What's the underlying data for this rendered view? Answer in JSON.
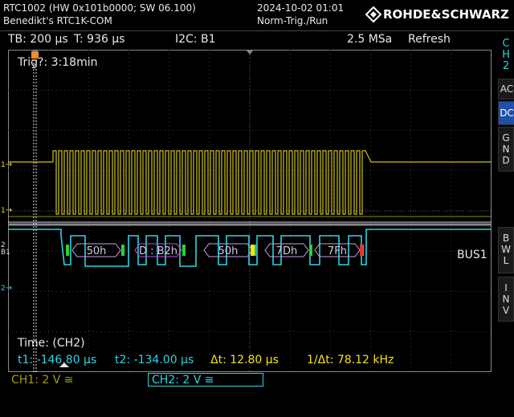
{
  "header": {
    "device": "RTC1002 (HW 0x101b0000; SW 06.100)",
    "user": "Benedikt's RTC1K-COM",
    "datetime": "2024-10-02 01:01",
    "trigger_state": "Norm-Trig./Run",
    "brand": "ROHDE&SCHWARZ"
  },
  "toolbar": {
    "timebase": "TB: 200 µs",
    "trigger_time": "T: 936 µs",
    "bus": "I2C: B1",
    "sample_rate": "2.5 MSa",
    "mode": "Refresh"
  },
  "side_panel": {
    "channel_label": "C\nH\n2",
    "ac": "AC",
    "dc": "DC",
    "gnd": "G\nN\nD",
    "bwl": "B\nW\nL",
    "inv": "I\nN\nV"
  },
  "screen": {
    "trig_status": "Trig?: 3:18min",
    "bus_label": "BUS1",
    "time_source": "Time: (CH2)",
    "bus_frames": [
      "50h",
      "D : B2h",
      "50h",
      "7Dh",
      "7Fh"
    ]
  },
  "measurements": {
    "t1": "t1: -146.80 µs",
    "t2": "t2: -134.00 µs",
    "dt": "Δt: 12.80 µs",
    "inv_dt": "1/Δt: 78.12 kHz"
  },
  "status": {
    "ch1": "CH1: 2 V ≅",
    "ch2": "CH2: 2 V ≅"
  },
  "colors": {
    "ch1": "#f2e416",
    "ch2": "#2ed3e6",
    "bus": "#d9d9d9",
    "start": "#c94fd6",
    "ack": "#2fd12f",
    "stop": "#e33030",
    "orange": "#f08a2a"
  }
}
